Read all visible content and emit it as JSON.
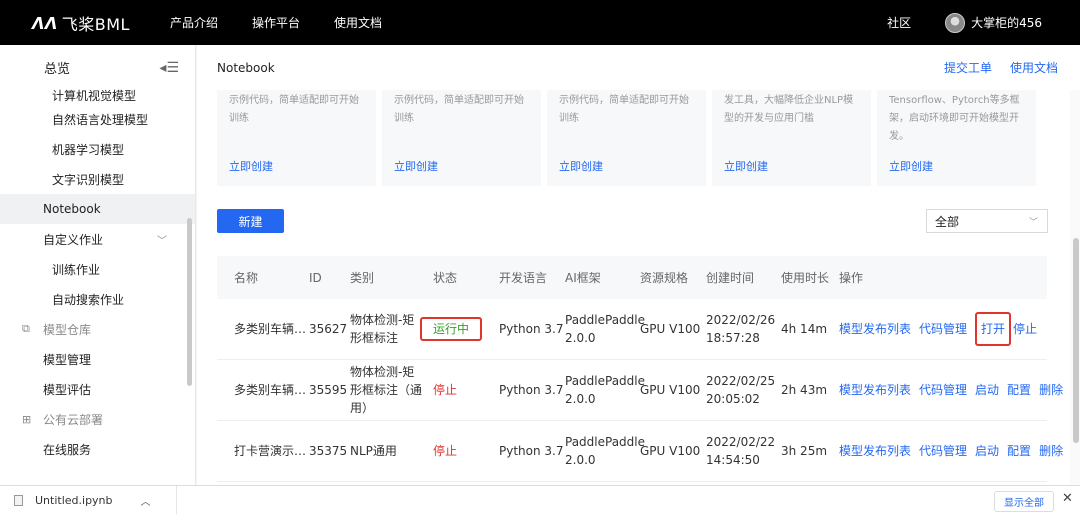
{
  "topbar": {
    "logo_mark": "ꟸꟹ",
    "logo_text": "飞桨BML",
    "nav": [
      "产品介绍",
      "操作平台",
      "使用文档"
    ],
    "community": "社区",
    "username": "大掌柜的456"
  },
  "sidebar": {
    "title": "总览",
    "items": [
      {
        "label": "计算机视觉模型",
        "kind": "sub-cut"
      },
      {
        "label": "自然语言处理模型",
        "kind": "sub"
      },
      {
        "label": "机器学习模型",
        "kind": "sub"
      },
      {
        "label": "文字识别模型",
        "kind": "sub"
      },
      {
        "label": "Notebook",
        "kind": "l1-active"
      },
      {
        "label": "自定义作业",
        "kind": "l1-expand"
      },
      {
        "label": "训练作业",
        "kind": "sub"
      },
      {
        "label": "自动搜索作业",
        "kind": "sub"
      },
      {
        "label": "模型仓库",
        "kind": "group",
        "icon": "cube-icon"
      },
      {
        "label": "模型管理",
        "kind": "l1"
      },
      {
        "label": "模型评估",
        "kind": "l1"
      },
      {
        "label": "公有云部署",
        "kind": "group",
        "icon": "grid-icon"
      },
      {
        "label": "在线服务",
        "kind": "l1"
      }
    ]
  },
  "header": {
    "title": "Notebook",
    "links": [
      "提交工单",
      "使用文档"
    ]
  },
  "cards": [
    {
      "desc": "示例代码，简单适配即可开始训练",
      "create": "立即创建"
    },
    {
      "desc": "示例代码，简单适配即可开始训练",
      "create": "立即创建"
    },
    {
      "desc": "示例代码，简单适配即可开始训练",
      "create": "立即创建"
    },
    {
      "desc": "发工具，大幅降低企业NLP模型的开发与应用门槛",
      "create": "立即创建"
    },
    {
      "desc": "Tensorflow、Pytorch等多框架，启动环境即可开始模型开发。",
      "create": "立即创建"
    }
  ],
  "toolbar": {
    "new_label": "新建",
    "filter_value": "全部"
  },
  "table": {
    "headers": [
      "名称",
      "ID",
      "类别",
      "状态",
      "开发语言",
      "AI框架",
      "资源规格",
      "创建时间",
      "使用时长",
      "操作"
    ],
    "rows": [
      {
        "name": "多类别车辆…",
        "id": "35627",
        "category": "物体检测-矩形框标注",
        "status": "运行中",
        "status_type": "running",
        "lang": "Python 3.7",
        "framework": "PaddlePaddle 2.0.0",
        "resource": "GPU V100",
        "created": "2022/02/26 18:57:28",
        "duration": "4h 14m",
        "actions": [
          "模型发布列表",
          "代码管理",
          "打开",
          "停止"
        ]
      },
      {
        "name": "多类别车辆…",
        "id": "35595",
        "category": "物体检测-矩形框标注（通用）",
        "status": "停止",
        "status_type": "stopped",
        "lang": "Python 3.7",
        "framework": "PaddlePaddle 2.0.0",
        "resource": "GPU V100",
        "created": "2022/02/25 20:05:02",
        "duration": "2h 43m",
        "actions": [
          "模型发布列表",
          "代码管理",
          "启动",
          "配置",
          "删除"
        ]
      },
      {
        "name": "打卡营演示…",
        "id": "35375",
        "category": "NLP通用",
        "status": "停止",
        "status_type": "stopped",
        "lang": "Python 3.7",
        "framework": "PaddlePaddle 2.0.0",
        "resource": "GPU V100",
        "created": "2022/02/22 14:54:50",
        "duration": "3h 25m",
        "actions": [
          "模型发布列表",
          "代码管理",
          "启动",
          "配置",
          "删除"
        ]
      }
    ]
  },
  "downloads": {
    "filename": "Untitled.ipynb",
    "show_all": "显示全部"
  },
  "colors": {
    "accent": "#2468f2",
    "running": "#33a02c",
    "stopped": "#e0342f",
    "highlight": "#e0342f"
  }
}
